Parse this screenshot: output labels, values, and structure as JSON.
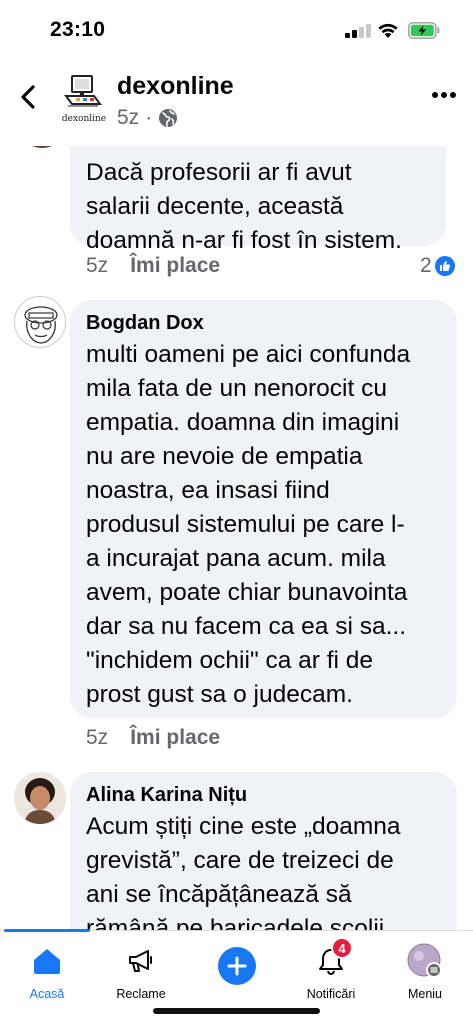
{
  "status_bar": {
    "time": "23:10"
  },
  "header": {
    "page_name": "dexonline",
    "meta_time": "5z",
    "meta_separator": "·",
    "logo_text": "dexonline"
  },
  "comments": [
    {
      "author": "",
      "text": "Dacă profesorii ar fi avut\nsalarii decente, această\ndoamnă n-ar fi fost în sistem.",
      "time": "5z",
      "like_label": "Îmi place",
      "reaction_count": "2"
    },
    {
      "author": "Bogdan Dox",
      "text": "multi oameni pe aici confunda\nmila fata de un nenorocit cu\nempatia. doamna din imagini\nnu are nevoie de empatia\nnoastra, ea insasi fiind\nprodusul sistemului pe care l-\na incurajat pana acum. mila\navem, poate chiar bunavointa\ndar sa nu facem ca ea si sa...\n\"inchidem ochii\" ca ar fi de\nprost gust sa o judecam.",
      "time": "5z",
      "like_label": "Îmi place"
    },
    {
      "author": "Alina Karina Nițu",
      "text": "Acum știți cine este „doamna\ngrevistă”, care de treizeci de\nani se încăpățânează să\nrămână pe baricadele școlii",
      "time": "",
      "like_label": ""
    }
  ],
  "tabbar": {
    "tabs": [
      {
        "label": "Acasă",
        "icon": "home-icon",
        "active": true
      },
      {
        "label": "Reclame",
        "icon": "megaphone-icon"
      },
      {
        "label": "",
        "icon": "plus-icon"
      },
      {
        "label": "Notificări",
        "icon": "bell-icon",
        "badge": "4"
      },
      {
        "label": "Meniu",
        "icon": "avatar-icon"
      }
    ]
  },
  "colors": {
    "accent": "#1877f2",
    "bubble": "#f0f2f5",
    "secondary_text": "#65676b",
    "badge": "#e41e3f"
  }
}
